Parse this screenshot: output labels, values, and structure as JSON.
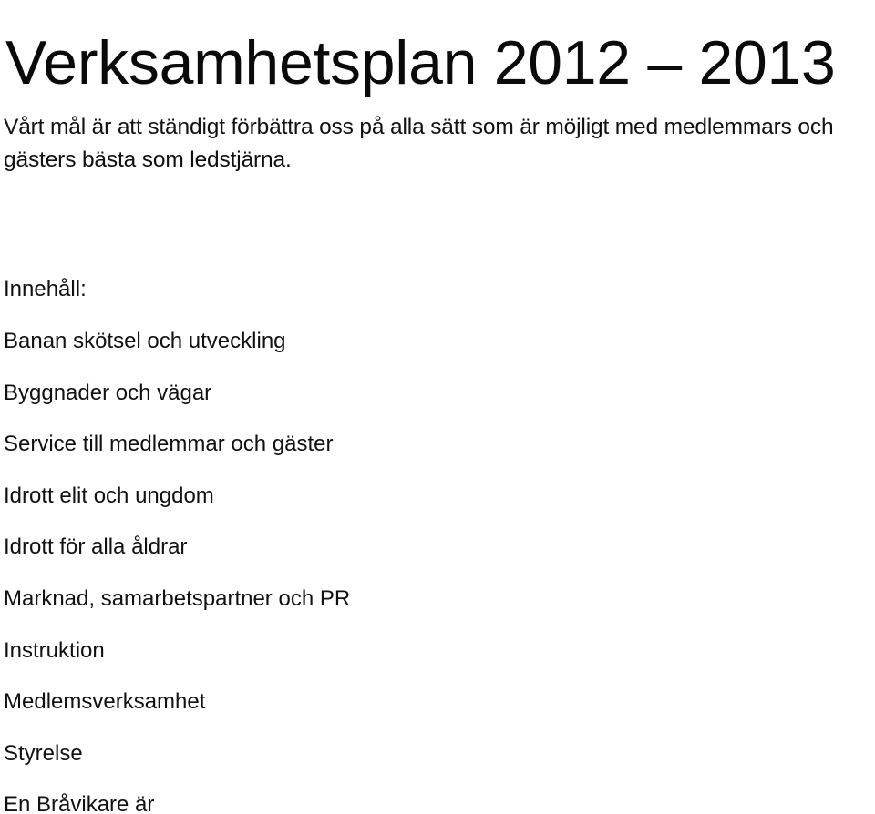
{
  "document": {
    "title": "Verksamhetsplan 2012 – 2013",
    "mission_statement": "Vårt mål är att ständigt förbättra oss på alla sätt som är möjligt med medlemmars och gästers bästa som ledstjärna.",
    "contents_heading": "Innehåll:",
    "contents_items": [
      {
        "label": "Banan skötsel och utveckling"
      },
      {
        "label": "Byggnader och vägar"
      },
      {
        "label": "Service till medlemmar och gäster"
      },
      {
        "label": "Idrott elit och ungdom"
      },
      {
        "label": "Idrott för alla åldrar"
      },
      {
        "label": "Marknad, samarbetspartner och PR"
      },
      {
        "label": "Instruktion"
      },
      {
        "label": "Medlemsverksamhet"
      },
      {
        "label": "Styrelse"
      },
      {
        "label": "En Bråvikare är"
      }
    ]
  },
  "colors": {
    "page_background": "#ffffff",
    "text": "#111111",
    "title_text": "#0a0a0a"
  }
}
